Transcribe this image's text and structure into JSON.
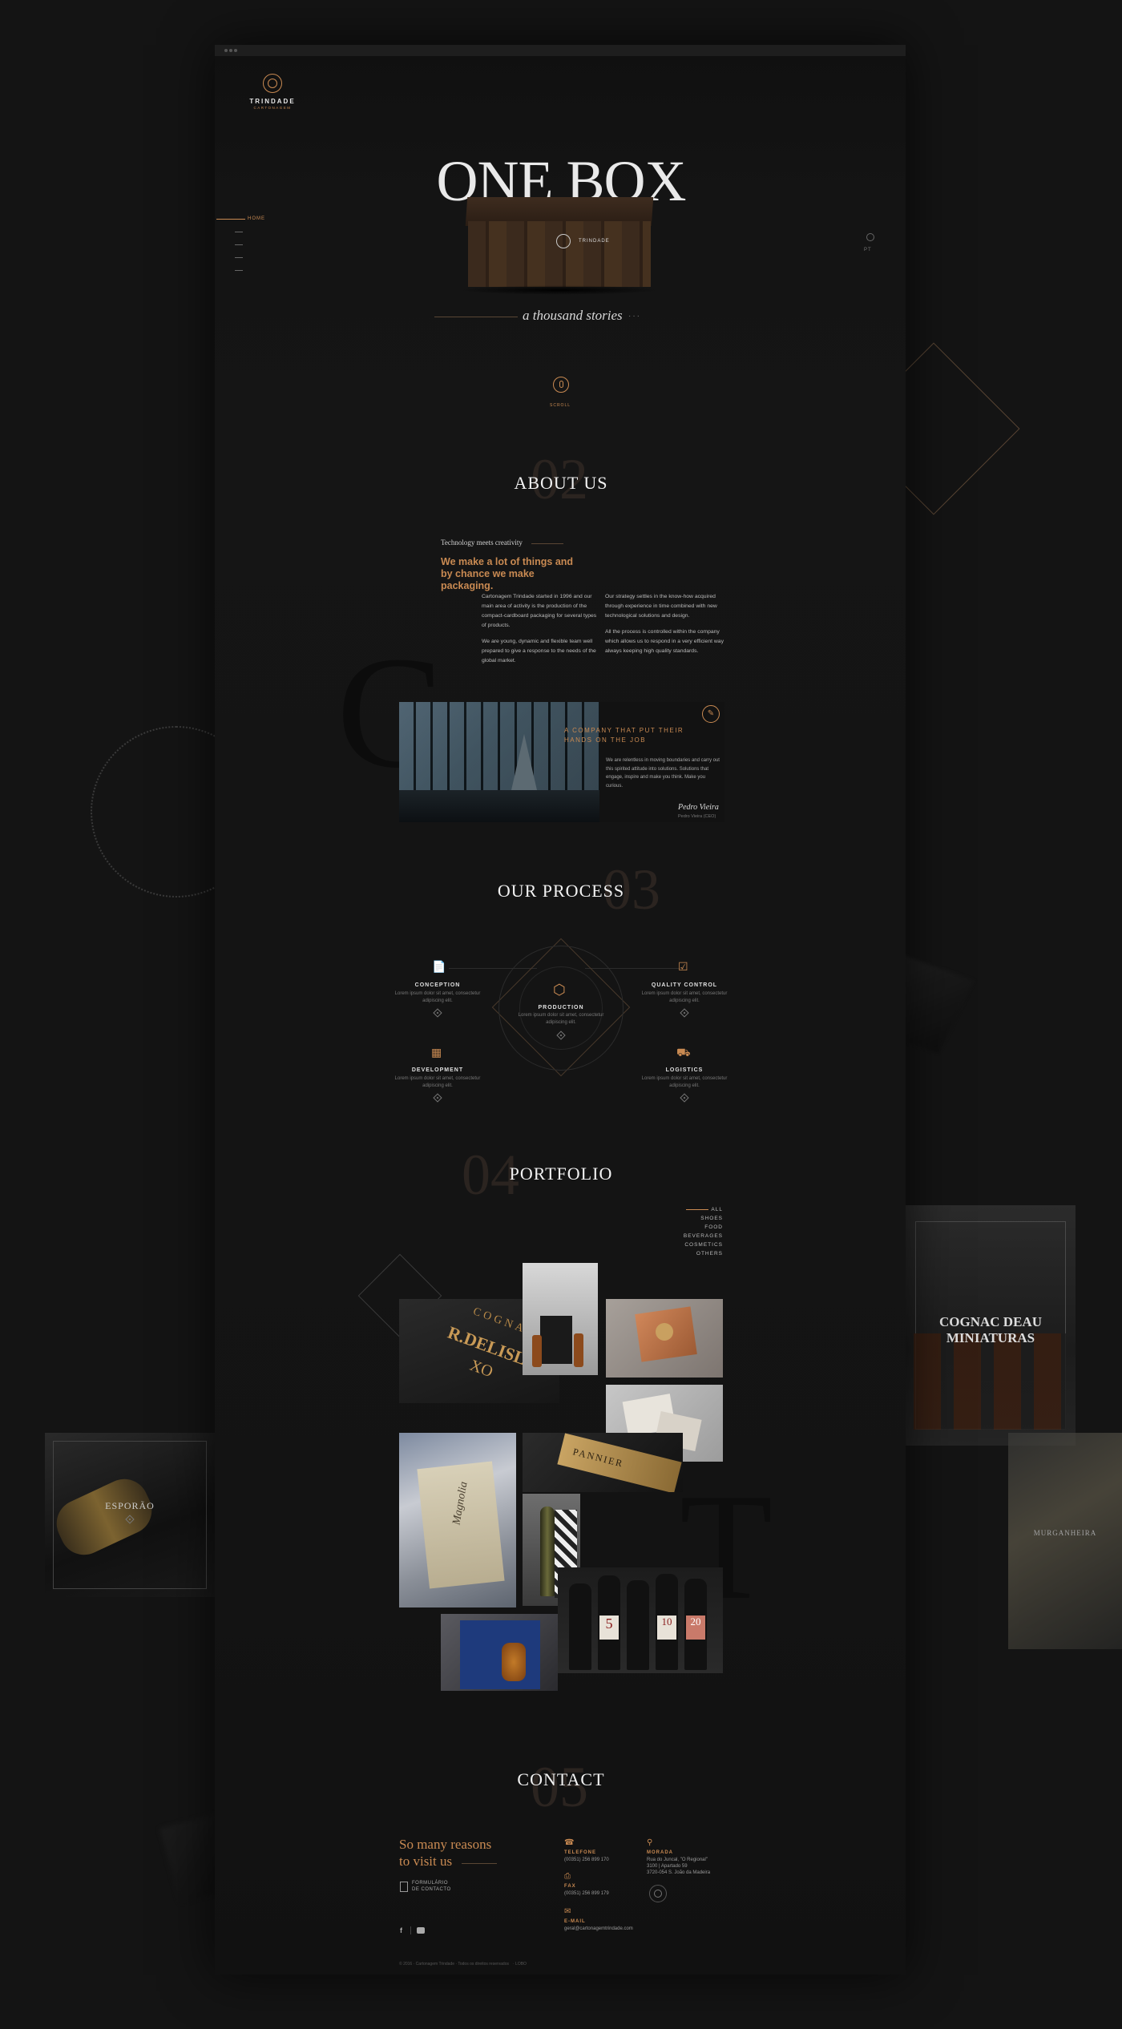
{
  "brand": {
    "name": "TRINDADE",
    "tagline": "CARTONAGEM"
  },
  "nav": {
    "active": "HOME",
    "items": [
      "",
      "",
      "",
      ""
    ]
  },
  "language": "PT",
  "hero": {
    "title": "ONE BOX",
    "subtitle": "a thousand stories",
    "scroll": "SCROLL",
    "box_label": "TRINDADE"
  },
  "about": {
    "number": "02",
    "title": "ABOUT US",
    "kicker": "Technology meets creativity",
    "headline": "We make a lot of things and by chance we make packaging.",
    "col1_p1": "Cartonagem Trindade started in 1996 and our main area of activity is the production of the compact-cardboard packaging for several types of products.",
    "col1_p2": "We are young, dynamic and flexible team well prepared to give a response to the needs of the global market.",
    "col2_p1": "Our strategy settles in the know-how acquired through experience in time combined with new technological solutions and design.",
    "col2_p2": "All the process is controlled within the company which allows us to respond in a very efficient way always keeping high quality standards.",
    "bg_letter": "C",
    "quote_heading": "A COMPANY THAT PUT THEIR HANDS ON THE JOB",
    "quote_text": "We are relentless in moving boundaries and carry out this spirited attitude into solutions. Solutions that engage, inspire and make you think. Make you curious.",
    "signature": "Pedro Vieira",
    "signature_role": "Pedro Vieira (CEO)"
  },
  "process": {
    "number": "03",
    "title": "OUR PROCESS",
    "steps": [
      {
        "label": "CONCEPTION",
        "desc": "Lorem ipsum dolor sit amet, consectetur adipiscing elit."
      },
      {
        "label": "QUALITY CONTROL",
        "desc": "Lorem ipsum dolor sit amet, consectetur adipiscing elit."
      },
      {
        "label": "PRODUCTION",
        "desc": "Lorem ipsum dolor sit amet, consectetur adipiscing elit."
      },
      {
        "label": "DEVELOPMENT",
        "desc": "Lorem ipsum dolor sit amet, consectetur adipiscing elit."
      },
      {
        "label": "LOGISTICS",
        "desc": "Lorem ipsum dolor sit amet, consectetur adipiscing elit."
      }
    ]
  },
  "portfolio": {
    "number": "04",
    "title": "PORTFOLIO",
    "filters": [
      "ALL",
      "SHOES",
      "FOOD",
      "BEVERAGES",
      "COSMETICS",
      "OTHERS"
    ],
    "bg_letter": "T",
    "tiles": {
      "cognac_brand": "COGNAC",
      "cognac_name": "R.DELISLE",
      "cognac_sub": "XO",
      "panier": "PANNIER",
      "magnolia": "Magnolia",
      "bottle_numbers": [
        "5",
        "10",
        "20"
      ]
    },
    "side_left": "ESPORÃO",
    "side_right_top_1": "COGNAC DEAU",
    "side_right_top_2": "MINIATURAS",
    "side_right_bottom": "MURGANHEIRA"
  },
  "contact": {
    "number": "05",
    "title": "CONTACT",
    "tagline_1": "So many reasons",
    "tagline_2": "to visit us",
    "form_link_1": "FORMULÁRIO",
    "form_link_2": "DE CONTACTO",
    "phone_label": "TELEFONE",
    "phone": "(00351) 256 899 170",
    "fax_label": "FAX",
    "fax": "(00351) 256 899 179",
    "email_label": "E-MAIL",
    "email": "geral@cartonagemtrindade.com",
    "address_label": "MORADA",
    "address_1": "Rua do Juncal, \"O Regional\"",
    "address_2": "3100 | Apartado 59",
    "address_3": "3720-054 S. João da Madeira"
  },
  "footer": {
    "copyright": "© 2016 · Cartonagem Trindade · Todos os direitos reservados",
    "credit": "· LOBO"
  },
  "colors": {
    "accent": "#c98a52",
    "background": "#141414",
    "panel": "#151515"
  }
}
